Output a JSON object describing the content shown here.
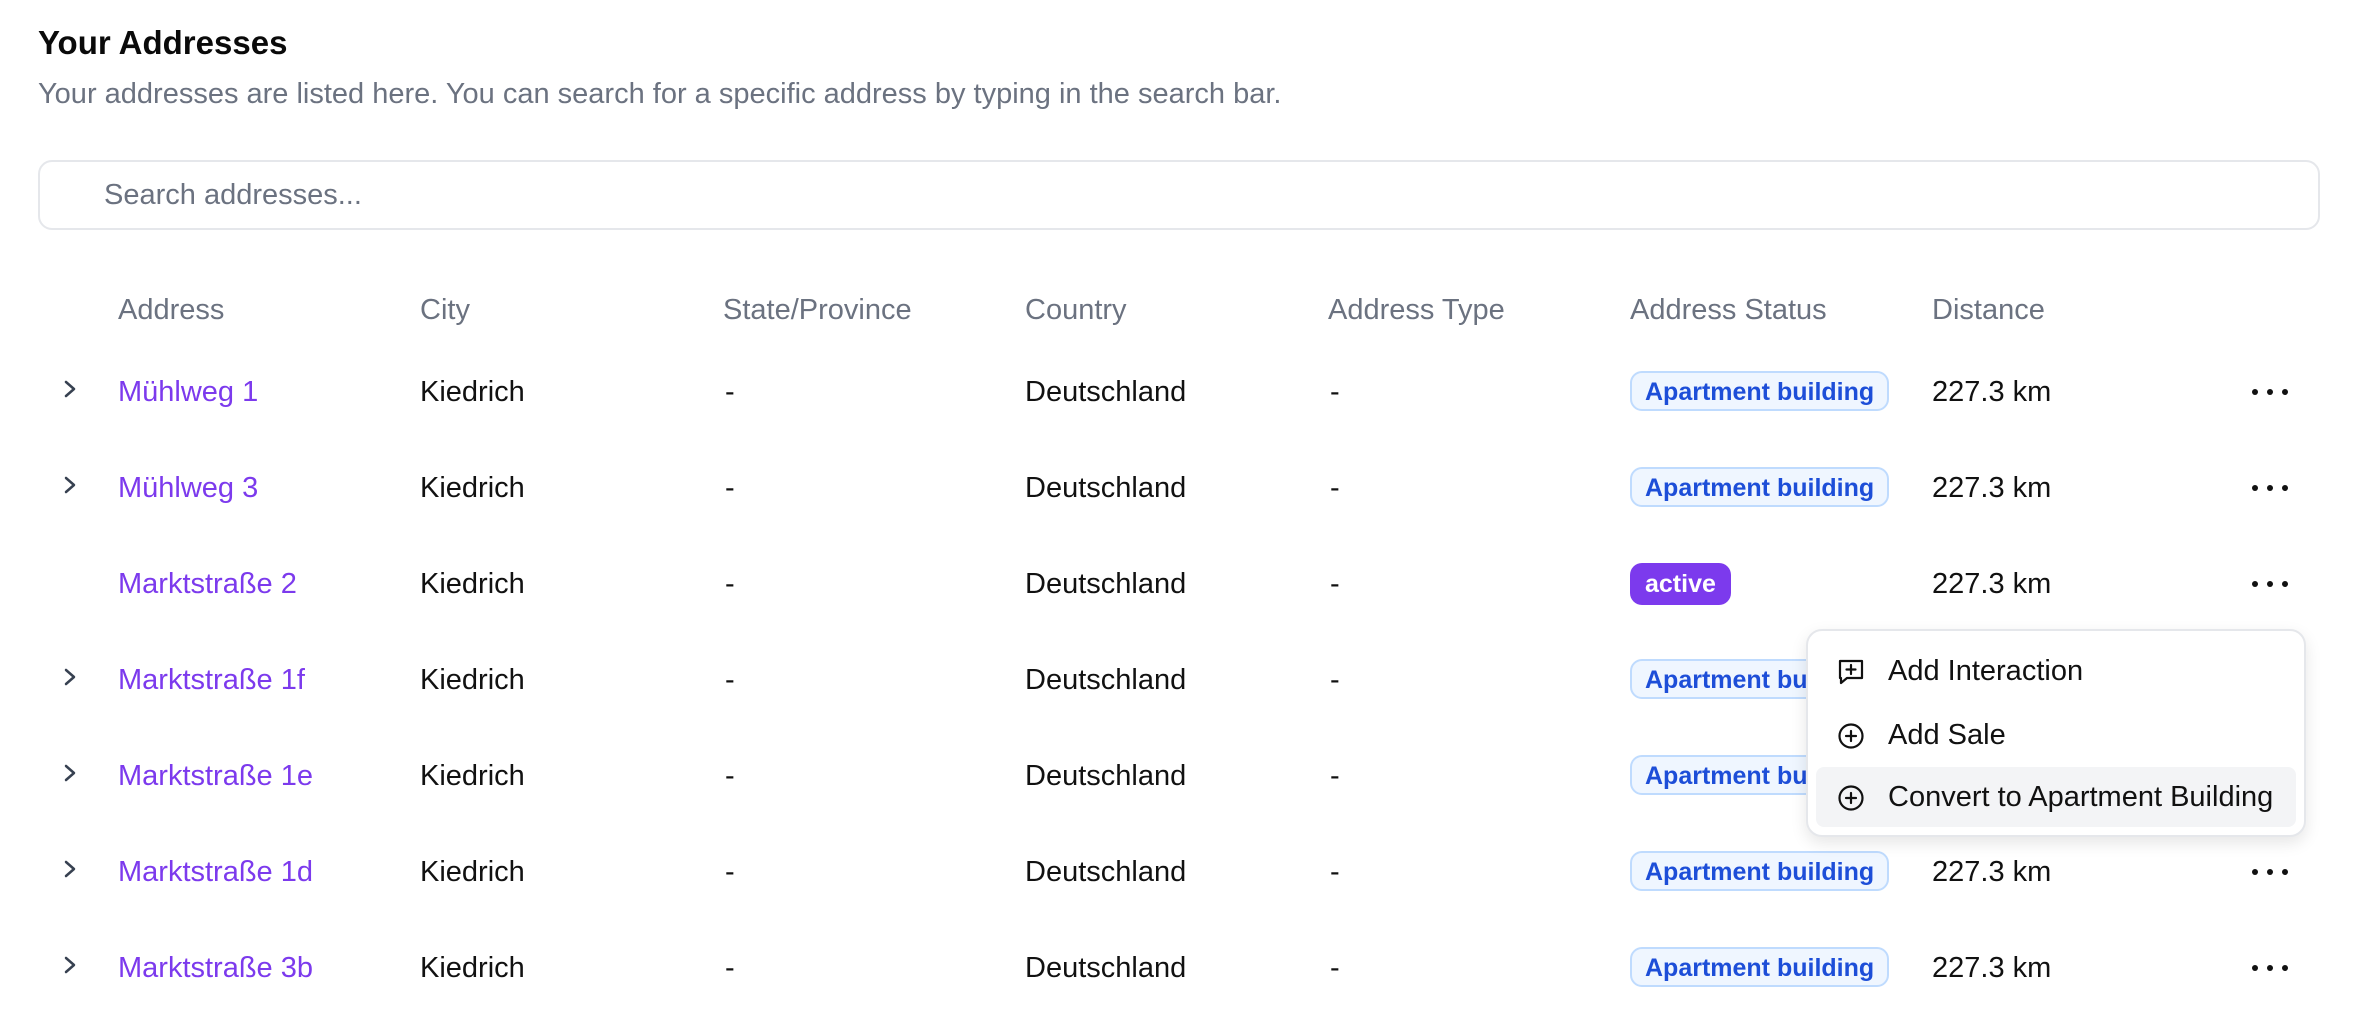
{
  "header": {
    "title": "Your Addresses",
    "subtitle": "Your addresses are listed here. You can search for a specific address by typing in the search bar."
  },
  "search": {
    "placeholder": "Search addresses...",
    "value": ""
  },
  "table": {
    "columns": [
      "Address",
      "City",
      "State/Province",
      "Country",
      "Address Type",
      "Address Status",
      "Distance"
    ],
    "rows": [
      {
        "address": "Mühlweg 1",
        "city": "Kiedrich",
        "state": "-",
        "country": "Deutschland",
        "type": "-",
        "status": "Apartment building",
        "distance": "227.3 km"
      },
      {
        "address": "Mühlweg 3",
        "city": "Kiedrich",
        "state": "-",
        "country": "Deutschland",
        "type": "-",
        "status": "Apartment building",
        "distance": "227.3 km"
      },
      {
        "address": "Marktstraße 2",
        "city": "Kiedrich",
        "state": "-",
        "country": "Deutschland",
        "type": "-",
        "status": "active",
        "distance": "227.3 km"
      },
      {
        "address": "Marktstraße 1f",
        "city": "Kiedrich",
        "state": "-",
        "country": "Deutschland",
        "type": "-",
        "status": "Apartment bu",
        "distance": ""
      },
      {
        "address": "Marktstraße 1e",
        "city": "Kiedrich",
        "state": "-",
        "country": "Deutschland",
        "type": "-",
        "status": "Apartment bu",
        "distance": ""
      },
      {
        "address": "Marktstraße 1d",
        "city": "Kiedrich",
        "state": "-",
        "country": "Deutschland",
        "type": "-",
        "status": "Apartment building",
        "distance": "227.3 km"
      },
      {
        "address": "Marktstraße 3b",
        "city": "Kiedrich",
        "state": "-",
        "country": "Deutschland",
        "type": "-",
        "status": "Apartment building",
        "distance": "227.3 km"
      }
    ]
  },
  "menu": {
    "items": [
      {
        "label": "Add Interaction",
        "icon": "message-plus-icon"
      },
      {
        "label": "Add Sale",
        "icon": "plus-circle-icon"
      },
      {
        "label": "Convert to Apartment Building",
        "icon": "plus-circle-icon"
      }
    ]
  },
  "colors": {
    "link": "#7c3aed",
    "badge_text": "#1d4ed8",
    "badge_bg": "#eff6ff",
    "active_bg": "#7c3aed",
    "muted": "#6b7280"
  }
}
